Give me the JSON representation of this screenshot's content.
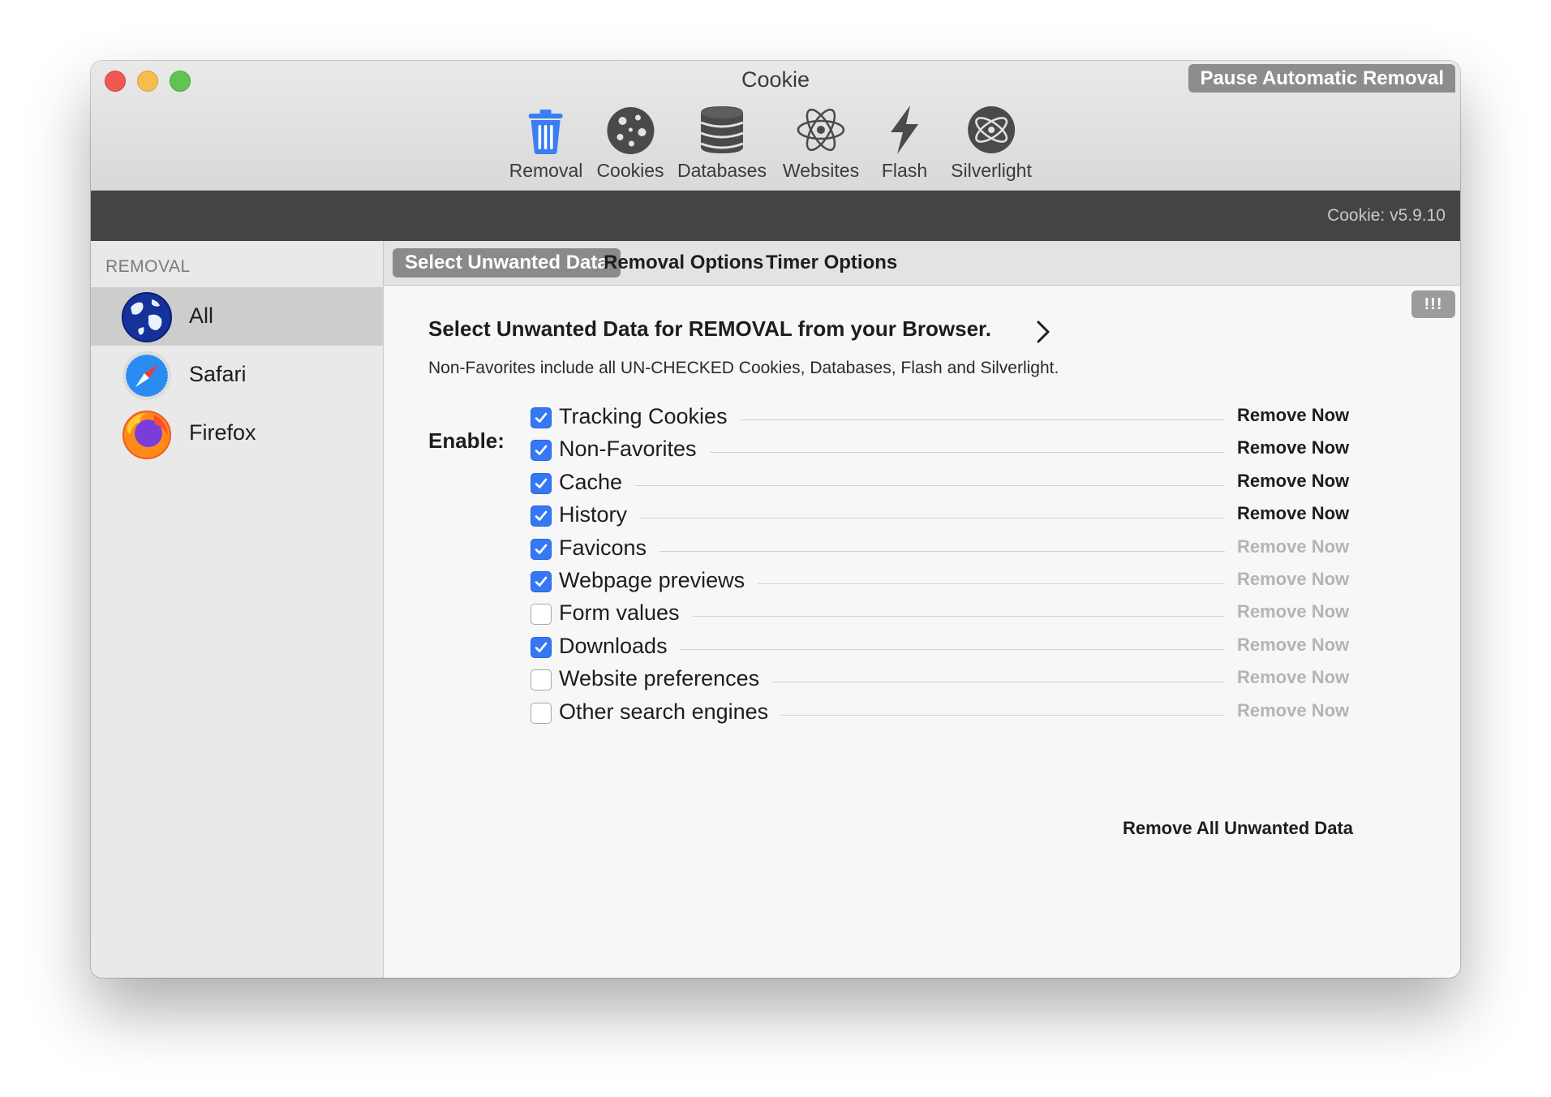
{
  "window": {
    "title": "Cookie",
    "pause_button": "Pause Automatic Removal",
    "version": "Cookie: v5.9.10"
  },
  "toolbar": {
    "items": [
      {
        "label": "Removal",
        "icon": "trash-icon"
      },
      {
        "label": "Cookies",
        "icon": "cookie-icon"
      },
      {
        "label": "Databases",
        "icon": "database-icon"
      },
      {
        "label": "Websites",
        "icon": "atom-icon"
      },
      {
        "label": "Flash",
        "icon": "flash-icon"
      },
      {
        "label": "Silverlight",
        "icon": "silverlight-icon"
      }
    ],
    "active": "Removal"
  },
  "sidebar": {
    "heading": "REMOVAL",
    "items": [
      {
        "label": "All",
        "icon": "globe-icon",
        "selected": true
      },
      {
        "label": "Safari",
        "icon": "safari-icon",
        "selected": false
      },
      {
        "label": "Firefox",
        "icon": "firefox-icon",
        "selected": false
      }
    ]
  },
  "tabs": [
    {
      "label": "Select Unwanted Data",
      "active": true
    },
    {
      "label": "Removal Options",
      "active": false
    },
    {
      "label": "Timer Options",
      "active": false
    }
  ],
  "main": {
    "alert_button": "!!!",
    "heading": "Select Unwanted Data for REMOVAL from your Browser.",
    "subtext": "Non-Favorites include all UN-CHECKED Cookies, Databases, Flash and Silverlight.",
    "enable_label": "Enable:",
    "options": [
      {
        "label": "Tracking Cookies",
        "checked": true,
        "action": "Remove Now",
        "action_enabled": true
      },
      {
        "label": "Non-Favorites",
        "checked": true,
        "action": "Remove Now",
        "action_enabled": true
      },
      {
        "label": "Cache",
        "checked": true,
        "action": "Remove Now",
        "action_enabled": true
      },
      {
        "label": "History",
        "checked": true,
        "action": "Remove Now",
        "action_enabled": true
      },
      {
        "label": "Favicons",
        "checked": true,
        "action": "Remove Now",
        "action_enabled": false
      },
      {
        "label": "Webpage previews",
        "checked": true,
        "action": "Remove Now",
        "action_enabled": false
      },
      {
        "label": "Form values",
        "checked": false,
        "action": "Remove Now",
        "action_enabled": false
      },
      {
        "label": "Downloads",
        "checked": true,
        "action": "Remove Now",
        "action_enabled": false
      },
      {
        "label": "Website preferences",
        "checked": false,
        "action": "Remove Now",
        "action_enabled": false
      },
      {
        "label": "Other search engines",
        "checked": false,
        "action": "Remove Now",
        "action_enabled": false
      }
    ],
    "remove_all": "Remove All Unwanted Data"
  },
  "colors": {
    "accent": "#3478f6",
    "tab_active": "#8a8a8a",
    "dark_strip": "#444444",
    "disabled_text": "#b4b4b4"
  }
}
